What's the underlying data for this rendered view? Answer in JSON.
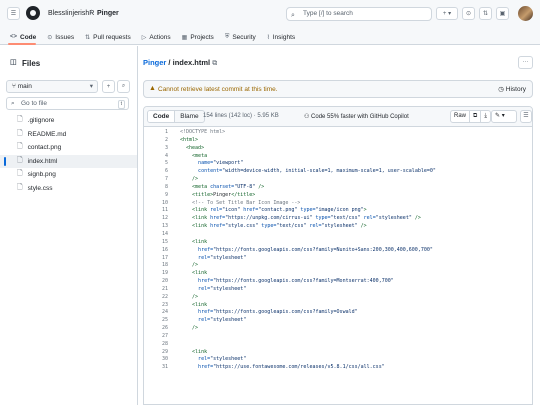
{
  "header": {
    "owner": "BlessIinjerishR",
    "separator": "/",
    "repo": "Pinger",
    "search_placeholder": "Type [/] to search",
    "plus_label": "+ ▾"
  },
  "tabs": [
    {
      "label": "Code",
      "icon": "<>"
    },
    {
      "label": "Issues",
      "icon": "⊙"
    },
    {
      "label": "Pull requests",
      "icon": "⇅"
    },
    {
      "label": "Actions",
      "icon": "▷"
    },
    {
      "label": "Projects",
      "icon": "▦"
    },
    {
      "label": "Security",
      "icon": "⛨"
    },
    {
      "label": "Insights",
      "icon": "⌇"
    }
  ],
  "sidebar": {
    "title": "Files",
    "branch": "main",
    "goto_placeholder": "Go to file",
    "goto_key": "t",
    "files": [
      ".gitignore",
      "README.md",
      "contact.png",
      "index.html",
      "signb.png",
      "style.css"
    ],
    "selected_file": "index.html"
  },
  "breadcrumb": {
    "repo": "Pinger",
    "sep": " / ",
    "file": "index.html",
    "copy_icon": "⧉"
  },
  "warning": {
    "text": "Cannot retrieve latest commit at this time.",
    "history": "History"
  },
  "codebar": {
    "code": "Code",
    "blame": "Blame",
    "meta": "154 lines (142 loc) · 5.95 KB",
    "copilot": "Code 55% faster with GitHub Copilot",
    "raw": "Raw",
    "copy": "⧉",
    "download": "⤓",
    "edit": "✎ ▾",
    "symbols": "☰"
  },
  "accent": "#0969da",
  "warning_color": "#9a6700",
  "lines": [
    [
      [
        "cm",
        "<!DOCTYPE html>"
      ]
    ],
    [
      [
        "tg",
        "<html>"
      ]
    ],
    [
      [
        "tg",
        "  <head>"
      ]
    ],
    [
      [
        "tg",
        "    <meta"
      ]
    ],
    [
      [
        "at",
        "      name="
      ],
      [
        "st",
        "\"viewport\""
      ]
    ],
    [
      [
        "at",
        "      content="
      ],
      [
        "st",
        "\"width=device-width, initial-scale=1, maximum-scale=1, user-scalable=0\""
      ]
    ],
    [
      [
        "tg",
        "    />"
      ]
    ],
    [
      [
        "tg",
        "    <meta "
      ],
      [
        "at",
        "charset="
      ],
      [
        "st",
        "\"UTF-8\""
      ],
      [
        "tg",
        " />"
      ]
    ],
    [
      [
        "tg",
        "    <title>"
      ],
      [
        "",
        "Pinger"
      ],
      [
        "tg",
        "</title>"
      ]
    ],
    [
      [
        "cm",
        "    <!-- To Set Title Bar Icon Image -->"
      ]
    ],
    [
      [
        "tg",
        "    <link "
      ],
      [
        "at",
        "rel="
      ],
      [
        "st",
        "\"icon\""
      ],
      [
        "at",
        " href="
      ],
      [
        "st",
        "\"contact.png\""
      ],
      [
        "at",
        " type="
      ],
      [
        "st",
        "\"image/icon png\""
      ],
      [
        "tg",
        ">"
      ]
    ],
    [
      [
        "tg",
        "    <link "
      ],
      [
        "at",
        "href="
      ],
      [
        "st",
        "\"https://unpkg.com/cirrus-ui\""
      ],
      [
        "at",
        " type="
      ],
      [
        "st",
        "\"text/css\""
      ],
      [
        "at",
        " rel="
      ],
      [
        "st",
        "\"stylesheet\""
      ],
      [
        "tg",
        " />"
      ]
    ],
    [
      [
        "tg",
        "    <link "
      ],
      [
        "at",
        "href="
      ],
      [
        "st",
        "\"style.css\""
      ],
      [
        "at",
        " type="
      ],
      [
        "st",
        "\"text/css\""
      ],
      [
        "at",
        " rel="
      ],
      [
        "st",
        "\"stylesheet\""
      ],
      [
        "tg",
        " />"
      ]
    ],
    [],
    [
      [
        "tg",
        "    <link"
      ]
    ],
    [
      [
        "at",
        "      href="
      ],
      [
        "st",
        "\"https://fonts.googleapis.com/css?family=Nunito+Sans:200,300,400,600,700\""
      ]
    ],
    [
      [
        "at",
        "      rel="
      ],
      [
        "st",
        "\"stylesheet\""
      ]
    ],
    [
      [
        "tg",
        "    />"
      ]
    ],
    [
      [
        "tg",
        "    <link"
      ]
    ],
    [
      [
        "at",
        "      href="
      ],
      [
        "st",
        "\"https://fonts.googleapis.com/css?family=Montserrat:400,700\""
      ]
    ],
    [
      [
        "at",
        "      rel="
      ],
      [
        "st",
        "\"stylesheet\""
      ]
    ],
    [
      [
        "tg",
        "    />"
      ]
    ],
    [
      [
        "tg",
        "    <link"
      ]
    ],
    [
      [
        "at",
        "      href="
      ],
      [
        "st",
        "\"https://fonts.googleapis.com/css?family=Oswald\""
      ]
    ],
    [
      [
        "at",
        "      rel="
      ],
      [
        "st",
        "\"stylesheet\""
      ]
    ],
    [
      [
        "tg",
        "    />"
      ]
    ],
    [],
    [],
    [
      [
        "tg",
        "    <link"
      ]
    ],
    [
      [
        "at",
        "      rel="
      ],
      [
        "st",
        "\"stylesheet\""
      ]
    ],
    [
      [
        "at",
        "      href="
      ],
      [
        "st",
        "\"https://use.fontawesome.com/releases/v5.8.1/css/all.css\""
      ]
    ]
  ]
}
